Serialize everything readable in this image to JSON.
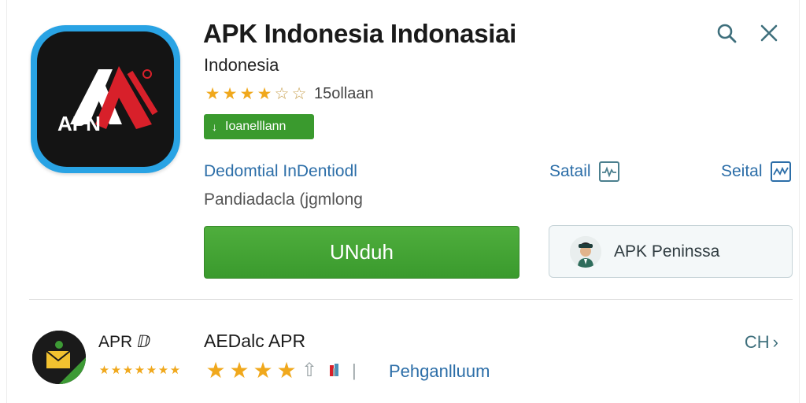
{
  "app": {
    "title": "APK Indonesia  Indonasiai",
    "subtitle": "Indonesia",
    "rating_text": "15ollaan",
    "rating_value": 3.5,
    "rating_max": 5,
    "badge_label": "Ioanelllann",
    "developer_link": "Dedomtial InDentiodl",
    "sub_info": "Pandiadacla (jgmlong",
    "stat_one_label": "Satail",
    "stat_two_label": "Seital",
    "install_label": "UNduh",
    "secondary_label": "APK Peninssa",
    "icon_text": "APN",
    "icon_colors": {
      "frame": "#29a3e4",
      "inner": "#141414",
      "accent": "#d8202a"
    }
  },
  "toolbar": {
    "icons": [
      "search-icon",
      "close-icon"
    ]
  },
  "related": {
    "mini_name": "APR ⅅ",
    "mini_stars": 7,
    "title": "AEDalc APR",
    "rating_value": 4,
    "link": "Pehganlluum",
    "more_label": "CH"
  },
  "colors": {
    "accent_green": "#3a9a2e",
    "link_blue": "#2c6ea8",
    "star_gold": "#f0a81c",
    "icon_teal": "#3e6f7c"
  }
}
